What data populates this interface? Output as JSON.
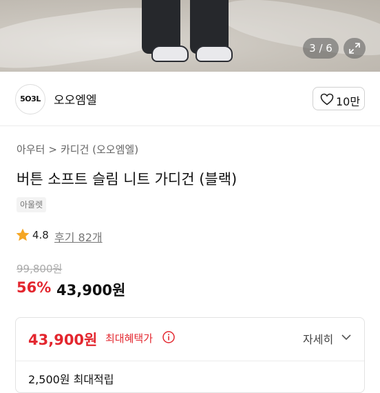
{
  "gallery": {
    "counter": "3 / 6"
  },
  "brand": {
    "logo_text": "5O3L",
    "name": "오오엠엘",
    "likes": "10만"
  },
  "breadcrumb": {
    "items": [
      "아우터",
      "카디건 (오오엠엘)"
    ],
    "separator": ">"
  },
  "product": {
    "title": "버튼 소프트 슬림 니트 가디건 (블랙)",
    "tag": "아울렛",
    "rating": "4.8",
    "reviews": "후기 82개",
    "original_price": "99,800원",
    "discount": "56%",
    "price": "43,900원"
  },
  "benefit": {
    "price": "43,900원",
    "label": "최대혜택가",
    "detail_label": "자세히",
    "points": "2,500원 최대적립"
  },
  "colors": {
    "accent_red": "#e3262e",
    "star": "#f5a623"
  }
}
